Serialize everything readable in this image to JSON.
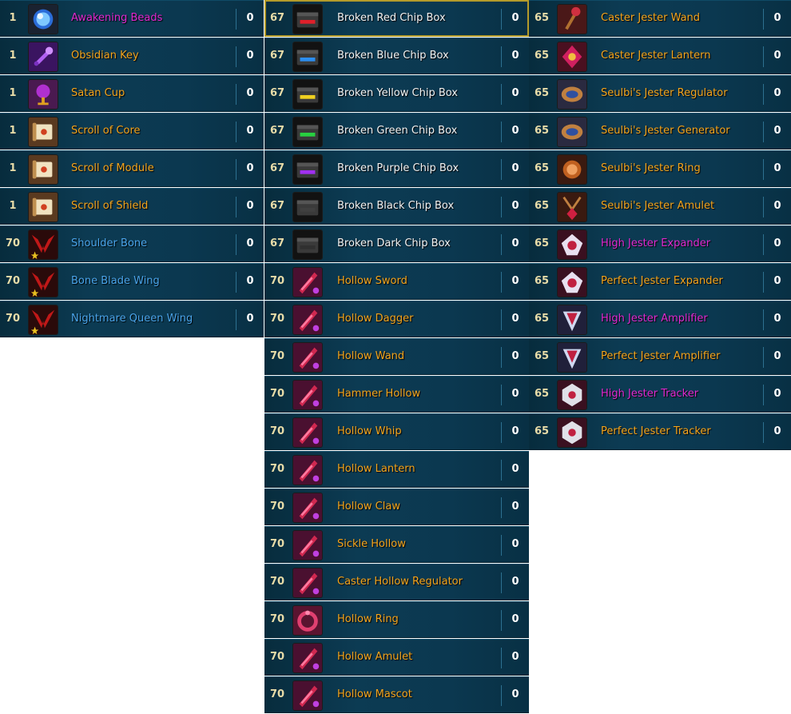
{
  "colors": {
    "orange": "#f4a41c",
    "magenta": "#e029d0",
    "blue": "#4aa4ea",
    "white": "#f1f1f1",
    "row_bg": "#0c3b53",
    "selected_border": "#b49b2a"
  },
  "columns": [
    {
      "items": [
        {
          "level": "1",
          "name": "Awakening Beads",
          "count": "0",
          "color": "magenta",
          "icon": "awakening-beads-icon"
        },
        {
          "level": "1",
          "name": "Obsidian Key",
          "count": "0",
          "color": "orange",
          "icon": "obsidian-key-icon"
        },
        {
          "level": "1",
          "name": "Satan Cup",
          "count": "0",
          "color": "orange",
          "icon": "satan-cup-icon"
        },
        {
          "level": "1",
          "name": "Scroll of Core",
          "count": "0",
          "color": "orange",
          "icon": "scroll-icon"
        },
        {
          "level": "1",
          "name": "Scroll of Module",
          "count": "0",
          "color": "orange",
          "icon": "scroll-icon"
        },
        {
          "level": "1",
          "name": "Scroll of Shield",
          "count": "0",
          "color": "orange",
          "icon": "scroll-icon"
        },
        {
          "level": "70",
          "name": "Shoulder Bone",
          "count": "0",
          "color": "blue",
          "icon": "wing-icon"
        },
        {
          "level": "70",
          "name": "Bone Blade Wing",
          "count": "0",
          "color": "blue",
          "icon": "wing-icon"
        },
        {
          "level": "70",
          "name": "Nightmare Queen Wing",
          "count": "0",
          "color": "blue",
          "icon": "wing-icon"
        }
      ]
    },
    {
      "items": [
        {
          "level": "67",
          "name": "Broken Red Chip Box",
          "count": "0",
          "color": "white",
          "icon": "chip-box-icon",
          "accent": "#e0202a",
          "selected": true
        },
        {
          "level": "67",
          "name": "Broken Blue Chip Box",
          "count": "0",
          "color": "white",
          "icon": "chip-box-icon",
          "accent": "#2c8ef0"
        },
        {
          "level": "67",
          "name": "Broken Yellow Chip Box",
          "count": "0",
          "color": "white",
          "icon": "chip-box-icon",
          "accent": "#f0d020"
        },
        {
          "level": "67",
          "name": "Broken Green Chip Box",
          "count": "0",
          "color": "white",
          "icon": "chip-box-icon",
          "accent": "#28d040"
        },
        {
          "level": "67",
          "name": "Broken Purple Chip Box",
          "count": "0",
          "color": "white",
          "icon": "chip-box-icon",
          "accent": "#a030f0"
        },
        {
          "level": "67",
          "name": "Broken Black Chip Box",
          "count": "0",
          "color": "white",
          "icon": "chip-box-icon",
          "accent": "#404040"
        },
        {
          "level": "67",
          "name": "Broken Dark Chip Box",
          "count": "0",
          "color": "white",
          "icon": "chip-box-icon",
          "accent": "#303030"
        },
        {
          "level": "70",
          "name": "Hollow Sword",
          "count": "0",
          "color": "orange",
          "icon": "hollow-weapon-icon"
        },
        {
          "level": "70",
          "name": "Hollow Dagger",
          "count": "0",
          "color": "orange",
          "icon": "hollow-weapon-icon"
        },
        {
          "level": "70",
          "name": "Hollow Wand",
          "count": "0",
          "color": "orange",
          "icon": "hollow-weapon-icon"
        },
        {
          "level": "70",
          "name": "Hammer Hollow",
          "count": "0",
          "color": "orange",
          "icon": "hollow-weapon-icon"
        },
        {
          "level": "70",
          "name": "Hollow Whip",
          "count": "0",
          "color": "orange",
          "icon": "hollow-weapon-icon"
        },
        {
          "level": "70",
          "name": "Hollow Lantern",
          "count": "0",
          "color": "orange",
          "icon": "hollow-weapon-icon"
        },
        {
          "level": "70",
          "name": "Hollow Claw",
          "count": "0",
          "color": "orange",
          "icon": "hollow-weapon-icon"
        },
        {
          "level": "70",
          "name": "Sickle Hollow",
          "count": "0",
          "color": "orange",
          "icon": "hollow-weapon-icon"
        },
        {
          "level": "70",
          "name": "Caster Hollow Regulator",
          "count": "0",
          "color": "orange",
          "icon": "hollow-weapon-icon"
        },
        {
          "level": "70",
          "name": "Hollow Ring",
          "count": "0",
          "color": "orange",
          "icon": "hollow-ring-icon"
        },
        {
          "level": "70",
          "name": "Hollow Amulet",
          "count": "0",
          "color": "orange",
          "icon": "hollow-weapon-icon"
        },
        {
          "level": "70",
          "name": "Hollow Mascot",
          "count": "0",
          "color": "orange",
          "icon": "hollow-weapon-icon"
        }
      ]
    },
    {
      "items": [
        {
          "level": "65",
          "name": "Caster Jester Wand",
          "count": "0",
          "color": "orange",
          "icon": "jester-wand-icon"
        },
        {
          "level": "65",
          "name": "Caster Jester Lantern",
          "count": "0",
          "color": "orange",
          "icon": "jester-lantern-icon"
        },
        {
          "level": "65",
          "name": "Seulbi's Jester Regulator",
          "count": "0",
          "color": "orange",
          "icon": "jester-regulator-icon"
        },
        {
          "level": "65",
          "name": "Seulbi's Jester Generator",
          "count": "0",
          "color": "orange",
          "icon": "jester-regulator-icon"
        },
        {
          "level": "65",
          "name": "Seulbi's Jester Ring",
          "count": "0",
          "color": "orange",
          "icon": "jester-ring-icon"
        },
        {
          "level": "65",
          "name": "Seulbi's Jester Amulet",
          "count": "0",
          "color": "orange",
          "icon": "jester-amulet-icon"
        },
        {
          "level": "65",
          "name": "High Jester Expander",
          "count": "0",
          "color": "magenta",
          "icon": "jester-expander-icon"
        },
        {
          "level": "65",
          "name": "Perfect Jester Expander",
          "count": "0",
          "color": "orange",
          "icon": "jester-expander-icon"
        },
        {
          "level": "65",
          "name": "High Jester Amplifier",
          "count": "0",
          "color": "magenta",
          "icon": "jester-amplifier-icon"
        },
        {
          "level": "65",
          "name": "Perfect Jester Amplifier",
          "count": "0",
          "color": "orange",
          "icon": "jester-amplifier-icon"
        },
        {
          "level": "65",
          "name": "High Jester Tracker",
          "count": "0",
          "color": "magenta",
          "icon": "jester-tracker-icon"
        },
        {
          "level": "65",
          "name": "Perfect Jester Tracker",
          "count": "0",
          "color": "orange",
          "icon": "jester-tracker-icon"
        }
      ]
    }
  ]
}
